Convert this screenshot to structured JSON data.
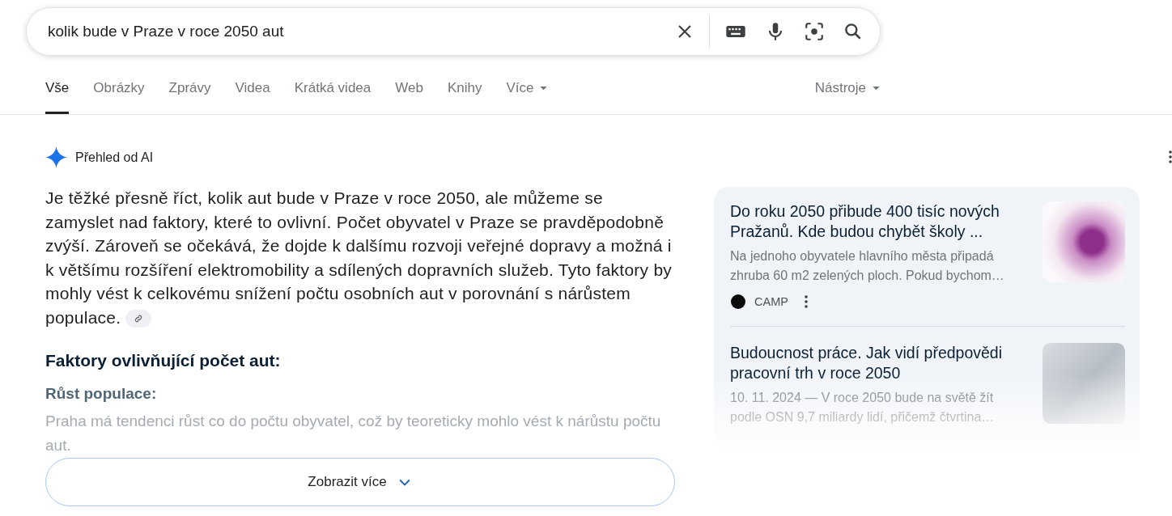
{
  "search": {
    "value": "kolik bude v Praze v roce 2050 aut"
  },
  "tabs": [
    {
      "label": "Vše",
      "selected": true,
      "kind": "plain"
    },
    {
      "label": "Obrázky",
      "selected": false,
      "kind": "plain"
    },
    {
      "label": "Zprávy",
      "selected": false,
      "kind": "plain"
    },
    {
      "label": "Videa",
      "selected": false,
      "kind": "plain"
    },
    {
      "label": "Krátká videa",
      "selected": false,
      "kind": "plain"
    },
    {
      "label": "Web",
      "selected": false,
      "kind": "plain"
    },
    {
      "label": "Knihy",
      "selected": false,
      "kind": "plain"
    },
    {
      "label": "Více",
      "selected": false,
      "kind": "menu"
    }
  ],
  "tools": {
    "label": "Nástroje"
  },
  "ai_overview": {
    "title": "Přehled od AI",
    "paragraph": "Je těžké přesně říct, kolik aut bude v Praze v roce 2050, ale můžeme se zamyslet nad faktory, které to ovlivní. Počet obyvatel v Praze se pravděpodobně zvýší. Zároveň se očekává, že dojde k dalšímu rozvoji veřejné dopravy a možná i k většímu rozšíření elektromobility a sdílených dopravních služeb. Tyto faktory by mohly vést k celkovému snížení počtu osobních aut v porovnání s nárůstem populace.",
    "heading": "Faktory ovlivňující počet aut:",
    "subheading": "Růst populace:",
    "faded_text": "Praha má tendenci růst co do počtu obyvatel, což by teoreticky mohlo vést k nárůstu počtu aut.",
    "show_more": "Zobrazit více"
  },
  "sources": [
    {
      "title": "Do roku 2050 přibude 400 tisíc nových Pražanů. Kde budou chybět školy ...",
      "snippet": "Na jednoho obyvatele hlavního města připadá zhruba 60 m2 zelených ploch. Pokud bychom…",
      "site": "CAMP",
      "kind": "map"
    },
    {
      "title": "Budoucnost práce. Jak vidí předpovědi pracovní trh v roce 2050",
      "snippet": "10. 11. 2024 — V roce 2050 bude na světě žít podle OSN 9,7 miliardy lidí, přičemž čtvrtina…",
      "kind": "illustration"
    }
  ]
}
